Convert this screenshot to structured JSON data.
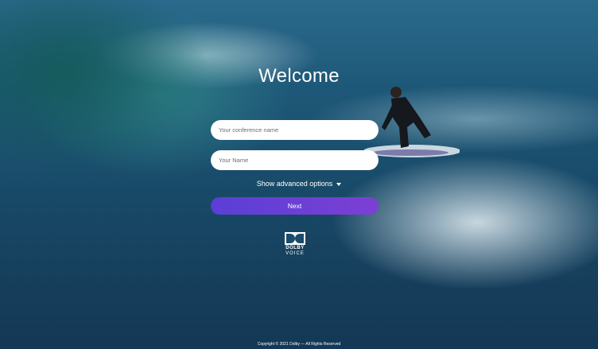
{
  "welcome": {
    "title": "Welcome",
    "conference_placeholder": "Your conference name",
    "name_placeholder": "Your Name",
    "advanced_label": "Show advanced options",
    "next_label": "Next"
  },
  "logo": {
    "line1": "DOLBY",
    "line2": "VOICE"
  },
  "footer": {
    "copyright": "Copyright © 2021 Dolby — All Rights Reserved"
  },
  "icons": {
    "advanced_toggle": "chevron-down-icon",
    "logo_mark": "dolby-double-d-icon"
  },
  "colors": {
    "button_gradient_start": "#5a3fd6",
    "button_gradient_end": "#7d3fd4",
    "text": "#ffffff"
  }
}
